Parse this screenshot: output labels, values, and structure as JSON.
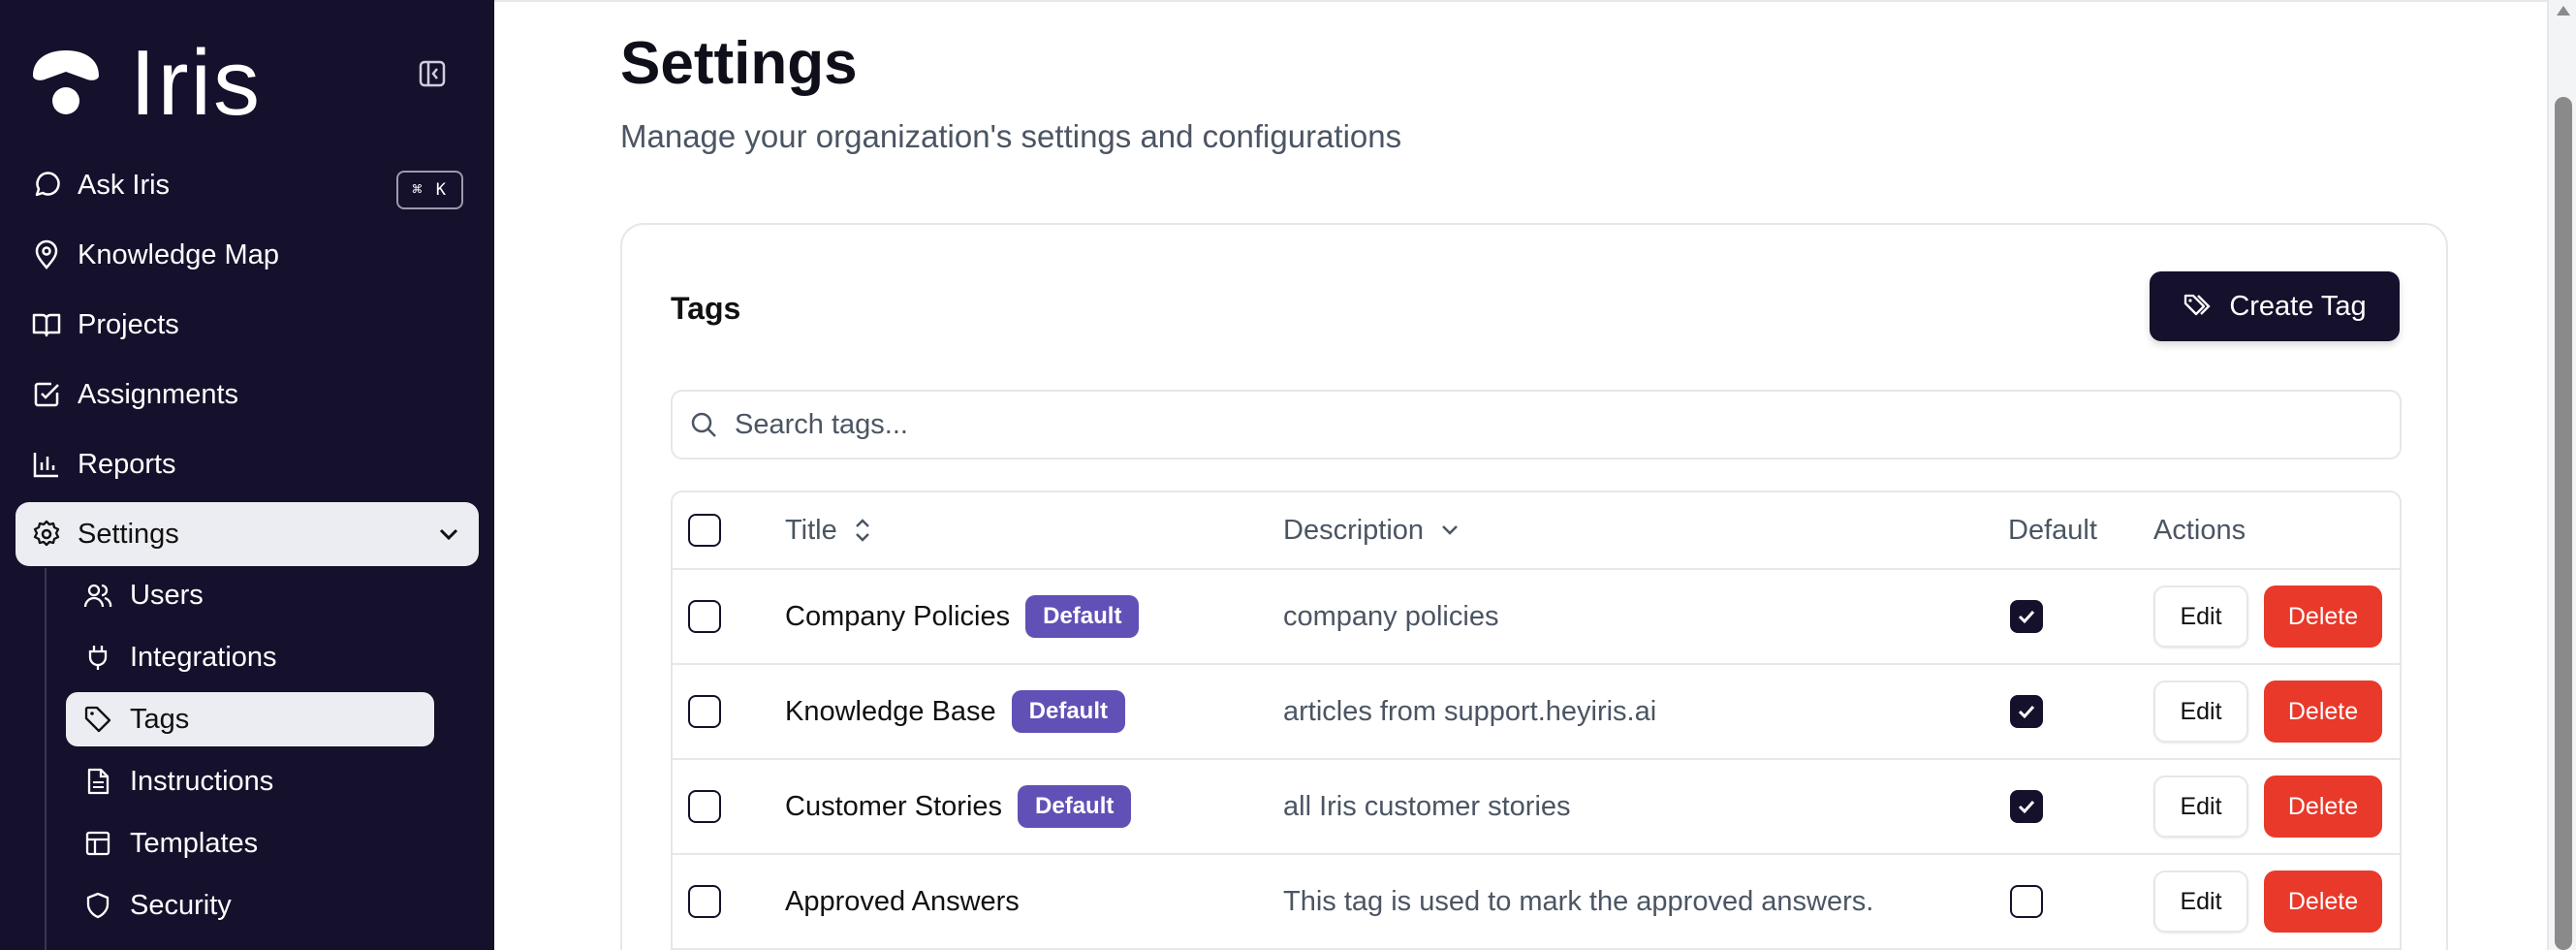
{
  "sidebar": {
    "logo_text": "Iris",
    "nav": [
      {
        "label": "Ask Iris",
        "icon": "chat-bubble-icon",
        "shortcut": "⌘ K"
      },
      {
        "label": "Knowledge Map",
        "icon": "map-pin-icon"
      },
      {
        "label": "Projects",
        "icon": "book-icon"
      },
      {
        "label": "Assignments",
        "icon": "checkbox-square-icon"
      },
      {
        "label": "Reports",
        "icon": "bar-chart-icon"
      },
      {
        "label": "Settings",
        "icon": "gear-icon",
        "active": true
      }
    ],
    "settings_sub": [
      {
        "label": "Users",
        "icon": "users-icon"
      },
      {
        "label": "Integrations",
        "icon": "plug-icon"
      },
      {
        "label": "Tags",
        "icon": "tag-icon",
        "active": true
      },
      {
        "label": "Instructions",
        "icon": "document-icon"
      },
      {
        "label": "Templates",
        "icon": "layout-icon"
      },
      {
        "label": "Security",
        "icon": "shield-icon"
      }
    ]
  },
  "page": {
    "title": "Settings",
    "subtitle": "Manage your organization's settings and configurations"
  },
  "tags_card": {
    "title": "Tags",
    "create_button": "Create Tag",
    "search_placeholder": "Search tags...",
    "columns": {
      "title": "Title",
      "description": "Description",
      "default": "Default",
      "actions": "Actions"
    },
    "rows": [
      {
        "title": "Company Policies",
        "badge": "Default",
        "description": "company policies",
        "is_default": true
      },
      {
        "title": "Knowledge Base",
        "badge": "Default",
        "description": "articles from support.heyiris.ai",
        "is_default": true
      },
      {
        "title": "Customer Stories",
        "badge": "Default",
        "description": "all Iris customer stories",
        "is_default": true
      },
      {
        "title": "Approved Answers",
        "badge": "",
        "description": "This tag is used to mark the approved answers.",
        "is_default": false
      }
    ],
    "edit_label": "Edit",
    "delete_label": "Delete"
  },
  "colors": {
    "sidebar_bg": "#15102b",
    "badge_bg": "#6150b6",
    "delete_bg": "#e8392a",
    "primary_button_bg": "#15102b"
  }
}
